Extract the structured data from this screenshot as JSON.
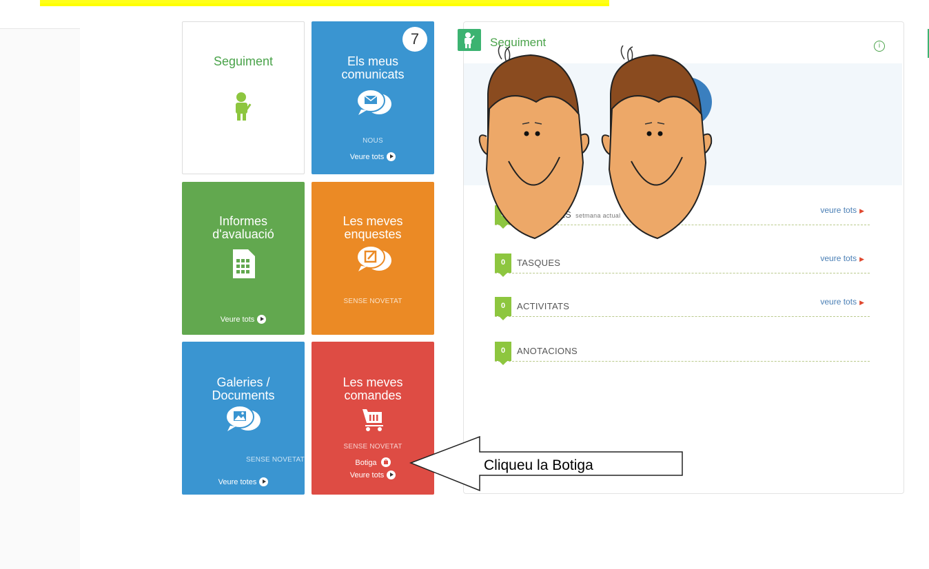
{
  "tiles": {
    "seguiment": {
      "title": "Seguiment"
    },
    "comunicats": {
      "title": "Els meus comunicats",
      "count": "7",
      "status": "NOUS",
      "link": "Veure tots"
    },
    "informes": {
      "title": "Informes d'avaluació",
      "link": "Veure tots"
    },
    "enquestes": {
      "title": "Les meves enquestes",
      "status": "SENSE NOVETAT"
    },
    "galeries": {
      "title": "Galeries / Documents",
      "status": "SENSE NOVETAT",
      "link": "Veure totes"
    },
    "comandes": {
      "title": "Les meves comandes",
      "status": "SENSE NOVETAT",
      "botiga": "Botiga",
      "link": "Veure tots"
    }
  },
  "panel": {
    "title": "Seguiment",
    "rows": [
      {
        "count": "0",
        "label": "…IES",
        "sub": "setmana actual",
        "link": "veure tots"
      },
      {
        "count": "0",
        "label": "TASQUES",
        "link": "veure tots"
      },
      {
        "count": "0",
        "label": "ACTIVITATS",
        "link": "veure tots"
      },
      {
        "count": "0",
        "label": "ANOTACIONS"
      }
    ]
  },
  "callout": {
    "text": "Cliqueu la Botiga"
  },
  "colors": {
    "blue": "#3a95d1",
    "green": "#62a84f",
    "orange": "#eb8a25",
    "red": "#de4c44",
    "badge_green": "#8dc63f",
    "banner_yellow": "#ffff00"
  },
  "icons": [
    "child-icon",
    "chat-mail-icon",
    "document-icon",
    "chat-edit-icon",
    "chat-image-icon",
    "cart-icon",
    "info-icon",
    "play-icon",
    "botiga-icon"
  ]
}
